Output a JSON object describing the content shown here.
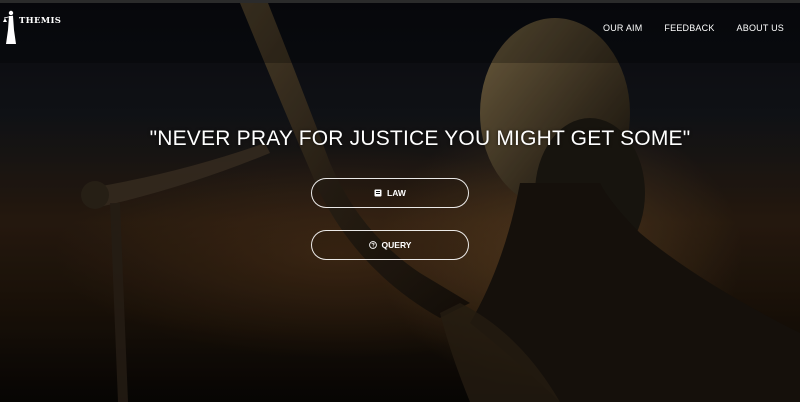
{
  "brand": {
    "name": "THEMIS"
  },
  "nav": [
    {
      "label": "OUR AIM"
    },
    {
      "label": "FEEDBACK"
    },
    {
      "label": "ABOUT US"
    }
  ],
  "hero": {
    "quote": "\"NEVER PRAY FOR JUSTICE YOU MIGHT GET SOME\"",
    "buttons": [
      {
        "label": "LAW",
        "icon": "book-icon"
      },
      {
        "label": "QUERY",
        "icon": "question-circle-icon"
      }
    ]
  },
  "colors": {
    "text": "#ffffff",
    "button_border": "#ffffff",
    "background_dark": "#0a0a0a"
  }
}
